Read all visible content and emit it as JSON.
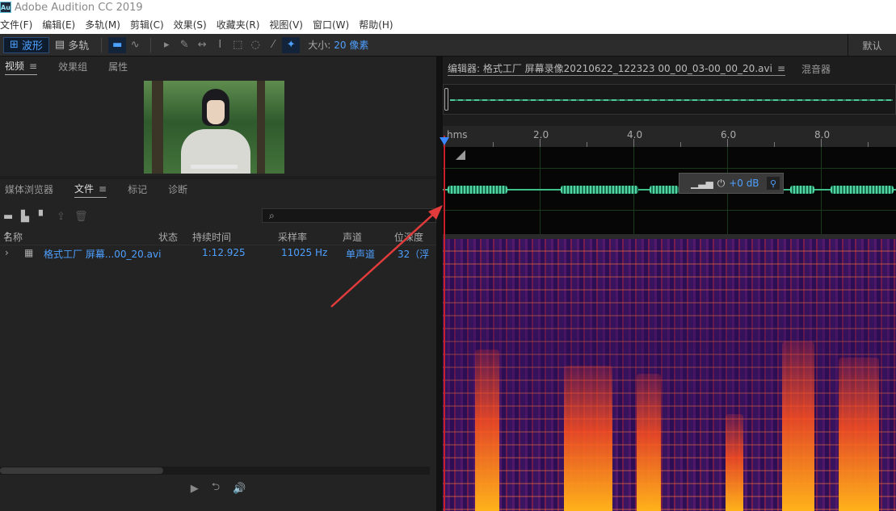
{
  "titlebar": {
    "logo": "Au",
    "title": "Adobe Audition CC 2019"
  },
  "menu": [
    "文件(F)",
    "编辑(E)",
    "多轨(M)",
    "剪辑(C)",
    "效果(S)",
    "收藏夹(R)",
    "视图(V)",
    "窗口(W)",
    "帮助(H)"
  ],
  "toolbar": {
    "waveform_label": "波形",
    "multitrack_label": "多轨",
    "size_label": "大小:",
    "size_value": "20 像素",
    "workspace_label": "默认"
  },
  "left_top_tabs": {
    "video": "视频",
    "effects_rack": "效果组",
    "properties": "属性"
  },
  "left_bottom_tabs": {
    "media_browser": "媒体浏览器",
    "files": "文件",
    "markers": "标记",
    "diagnostics": "诊断"
  },
  "files_search": {
    "icon": "search-icon"
  },
  "files_columns": {
    "name": "名称",
    "status": "状态",
    "duration": "持续时间",
    "sample_rate": "采样率",
    "channels": "声道",
    "bit_depth": "位深度"
  },
  "files_rows": [
    {
      "name": "格式工厂 屏幕...00_20.avi",
      "duration": "1:12.925",
      "sample_rate": "11025 Hz",
      "channels": "单声道",
      "bit_depth": "32（浮"
    }
  ],
  "editor_tabs": {
    "editor": "编辑器: 格式工厂 屏幕录像20210622_122323 00_00_03-00_00_20.avi",
    "mixer": "混音器"
  },
  "ruler": {
    "unit": "hms",
    "ticks": [
      "2.0",
      "4.0",
      "6.0",
      "8.0"
    ]
  },
  "hud": {
    "gain": "+0 dB"
  },
  "colors": {
    "accent": "#4ea0ff",
    "waveform": "#3fbf8a",
    "playhead": "#c8202a"
  }
}
